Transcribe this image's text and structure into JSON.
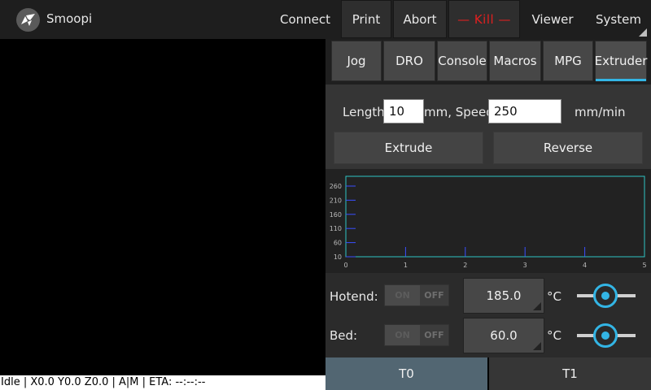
{
  "app": {
    "title": "Smoopi"
  },
  "topbar": {
    "connect": "Connect",
    "print": "Print",
    "abort": "Abort",
    "kill": "— Kill —",
    "viewer": "Viewer",
    "system": "System"
  },
  "tabs": [
    "Jog",
    "DRO",
    "Console",
    "Macros",
    "MPG",
    "Extruder"
  ],
  "active_tab": "Extruder",
  "extruder": {
    "length_label": "Length:",
    "length_value": "10",
    "speed_label": "mm, Speed:",
    "speed_value": "250",
    "unit_label": "mm/min",
    "extrude_label": "Extrude",
    "reverse_label": "Reverse"
  },
  "graph": {
    "y_ticks": [
      "260",
      "210",
      "160",
      "110",
      "60",
      "10"
    ],
    "x_ticks": [
      "0",
      "1",
      "2",
      "3",
      "4",
      "5"
    ],
    "ylim": [
      10,
      260
    ],
    "xlim": [
      0,
      5
    ],
    "border_color": "#2ec4c4",
    "tick_color": "#3a4fff"
  },
  "temps": {
    "hotend_label": "Hotend:",
    "bed_label": "Bed:",
    "on_label": "ON",
    "off_label": "OFF",
    "hotend_value": "185.0",
    "bed_value": "60.0",
    "unit": "°C"
  },
  "tools": {
    "t0": "T0",
    "t1": "T1"
  },
  "status": {
    "text": "Idle | X0.0 Y0.0 Z0.0 | A|M | ETA: --:--:--"
  },
  "colors": {
    "accent": "#33b5e5",
    "kill": "#e02020"
  }
}
